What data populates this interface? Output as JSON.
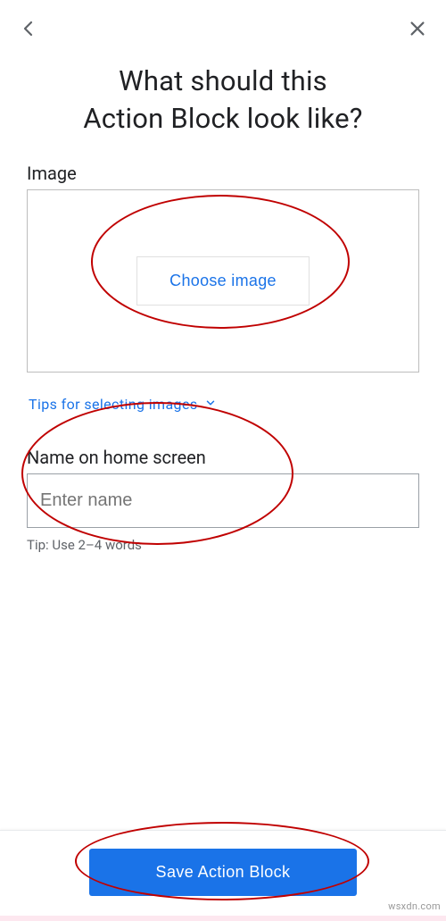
{
  "title_line1": "What should this",
  "title_line2": "Action Block look like?",
  "image": {
    "label": "Image",
    "choose_button": "Choose image",
    "tips_label": "Tips for selecting images"
  },
  "name": {
    "label": "Name on home screen",
    "placeholder": "Enter name",
    "hint": "Tip: Use 2–4 words"
  },
  "footer": {
    "save_label": "Save Action Block"
  },
  "watermark": "wsxdn.com"
}
